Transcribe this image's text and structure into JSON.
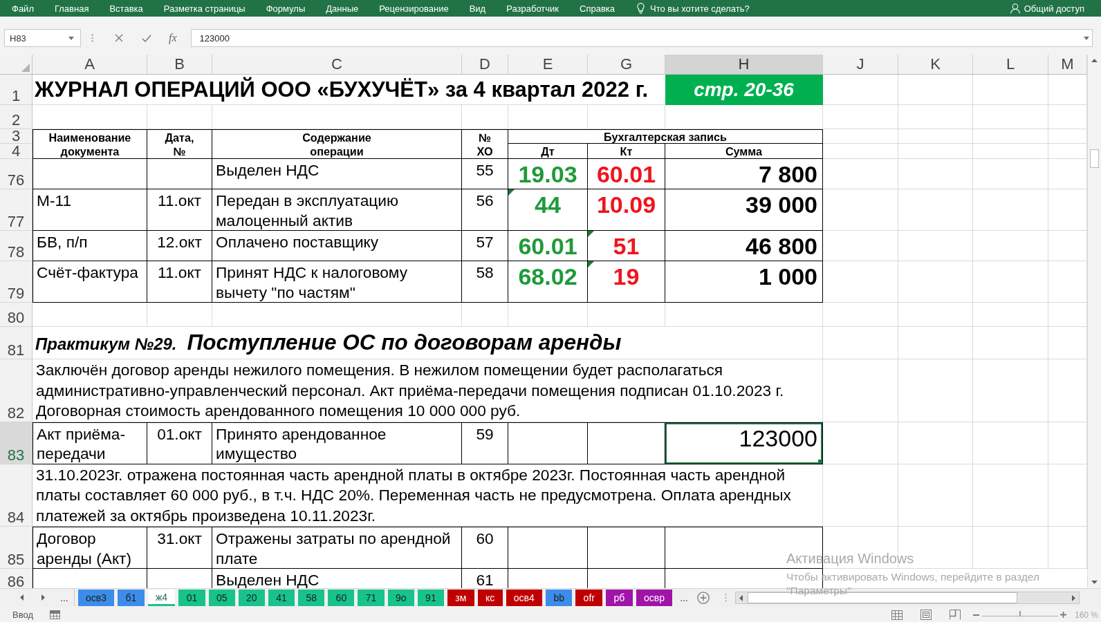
{
  "menu_bar": {
    "tabs": [
      "Файл",
      "Главная",
      "Вставка",
      "Разметка страницы",
      "Формулы",
      "Данные",
      "Рецензирование",
      "Вид",
      "Разработчик",
      "Справка"
    ],
    "tell_me": "Что вы хотите сделать?",
    "share": "Общий доступ"
  },
  "formula_bar": {
    "name_box": "H83",
    "function_button": "fx",
    "formula": "123000"
  },
  "columns": [
    {
      "label": "A",
      "selected": false
    },
    {
      "label": "B",
      "selected": false
    },
    {
      "label": "C",
      "selected": false
    },
    {
      "label": "D",
      "selected": false
    },
    {
      "label": "E",
      "selected": false
    },
    {
      "label": "G",
      "selected": false
    },
    {
      "label": "H",
      "selected": true
    },
    {
      "label": "J",
      "selected": false
    },
    {
      "label": "K",
      "selected": false
    },
    {
      "label": "L",
      "selected": false
    },
    {
      "label": "M",
      "selected": false
    }
  ],
  "rows": [
    {
      "number": "1",
      "selected": false,
      "kind": "title",
      "title": "ЖУРНАЛ ОПЕРАЦИЙ ООО «БУХУЧЁТ» за 4 квартал 2022 г.",
      "page_ref": "стр. 20-36"
    },
    {
      "number": "2",
      "selected": false,
      "kind": "blank"
    },
    {
      "kind": "table_header",
      "row_numbers": [
        {
          "number": "3",
          "selected": false
        },
        {
          "number": "4",
          "selected": false
        }
      ],
      "document": "Наименование\nдокумента",
      "date": "Дата,\n№",
      "content": "Содержание\nоперации",
      "op_number": "№\nХО",
      "entry": "Бухгалтерская запись",
      "debit": "Дт",
      "credit": "Кт",
      "amount": "Сумма"
    },
    {
      "number": "76",
      "selected": false,
      "kind": "entry",
      "content": "Выделен НДС",
      "op_number": "55",
      "debit": "19.03",
      "debit_flagged": false,
      "credit": "60.01",
      "credit_flagged": false,
      "amount": "7 800"
    },
    {
      "number": "77",
      "selected": false,
      "kind": "entry",
      "document": "М-11",
      "date": "11.окт",
      "content": "Передан в эксплуатацию малоценный актив",
      "op_number": "56",
      "debit": "44",
      "debit_flagged": true,
      "credit": "10.09",
      "credit_flagged": false,
      "amount": "39 000"
    },
    {
      "number": "78",
      "selected": false,
      "kind": "entry",
      "document": "БВ, п/п",
      "date": "12.окт",
      "content": "Оплачено поставщику",
      "op_number": "57",
      "debit": "60.01",
      "debit_flagged": false,
      "credit": "51",
      "credit_flagged": true,
      "amount": "46 800"
    },
    {
      "number": "79",
      "selected": false,
      "kind": "entry",
      "document": "Счёт-фактура",
      "date": "11.окт",
      "content": "Принят НДС к налоговому вычету \"по частям\"",
      "op_number": "58",
      "debit": "68.02",
      "debit_flagged": false,
      "credit": "19",
      "credit_flagged": true,
      "amount": "1 000"
    },
    {
      "number": "80",
      "selected": false,
      "kind": "blank"
    },
    {
      "number": "81",
      "selected": false,
      "kind": "section",
      "label": "Практикум №29.",
      "title": "Поступление ОС по договорам аренды"
    },
    {
      "number": "82",
      "selected": false,
      "kind": "note",
      "text": "Заключён договор аренды нежилого помещения. В нежилом помещении будет располагаться административно-управленческий персонал. Акт приёма-передачи помещения подписан 01.10.2023 г. Договорная стоимость арендованного помещения 10 000 000 руб."
    },
    {
      "number": "83",
      "selected": true,
      "kind": "entry",
      "document": "Акт приёма-передачи",
      "date": "01.окт",
      "content": "Принято арендованное имущество",
      "op_number": "59",
      "debit_flagged": false,
      "credit_flagged": false,
      "amount": "123000"
    },
    {
      "number": "84",
      "selected": false,
      "kind": "note",
      "text": "31.10.2023г. отражена постоянная часть арендной платы в октябре 2023г. Постоянная часть арендной платы составляет 60 000 руб., в т.ч. НДС 20%. Переменная часть не предусмотрена. Оплата арендных платежей за октябрь произведена 10.11.2023г."
    },
    {
      "number": "85",
      "selected": false,
      "kind": "entry",
      "document": "Договор аренды (Акт)",
      "date": "31.окт",
      "content": "Отражены затраты по арендной плате",
      "op_number": "60",
      "debit_flagged": false,
      "credit_flagged": false
    },
    {
      "number": "86",
      "selected": false,
      "kind": "entry",
      "content": "Выделен НДС",
      "op_number": "61",
      "debit_flagged": false,
      "credit_flagged": false
    }
  ],
  "sheet_tabs": {
    "more_left": "...",
    "tabs": [
      {
        "label": "осв3",
        "color": "#3c8dea",
        "selected": false
      },
      {
        "label": "б1",
        "color": "#3c8dea",
        "selected": false
      },
      {
        "label": "ж4",
        "color": "#17c38b",
        "selected": true
      },
      {
        "label": "01",
        "color": "#17c38b",
        "selected": false
      },
      {
        "label": "05",
        "color": "#17c38b",
        "selected": false
      },
      {
        "label": "20",
        "color": "#17c38b",
        "selected": false
      },
      {
        "label": "41",
        "color": "#17c38b",
        "selected": false
      },
      {
        "label": "58",
        "color": "#17c38b",
        "selected": false
      },
      {
        "label": "60",
        "color": "#17c38b",
        "selected": false
      },
      {
        "label": "71",
        "color": "#17c38b",
        "selected": false
      },
      {
        "label": "9о",
        "color": "#17c38b",
        "selected": false
      },
      {
        "label": "91",
        "color": "#17c38b",
        "selected": false
      },
      {
        "label": "зм",
        "color": "#c00000",
        "selected": false
      },
      {
        "label": "кс",
        "color": "#c00000",
        "selected": false
      },
      {
        "label": "осв4",
        "color": "#c00000",
        "selected": false
      },
      {
        "label": "bb",
        "color": "#3c8dea",
        "selected": false
      },
      {
        "label": "ofr",
        "color": "#c00000",
        "selected": false
      },
      {
        "label": "рб",
        "color": "#a014a8",
        "selected": false
      },
      {
        "label": "освр",
        "color": "#a014a8",
        "selected": false
      }
    ],
    "more_right": "..."
  },
  "status_bar": {
    "mode": "Ввод",
    "zoom_slider": {
      "level": 0.5
    },
    "zoom": "160 %"
  },
  "activation_notice": {
    "title": "Активация Windows",
    "text": "Чтобы активировать Windows, перейдите в раздел \"Параметры\""
  }
}
